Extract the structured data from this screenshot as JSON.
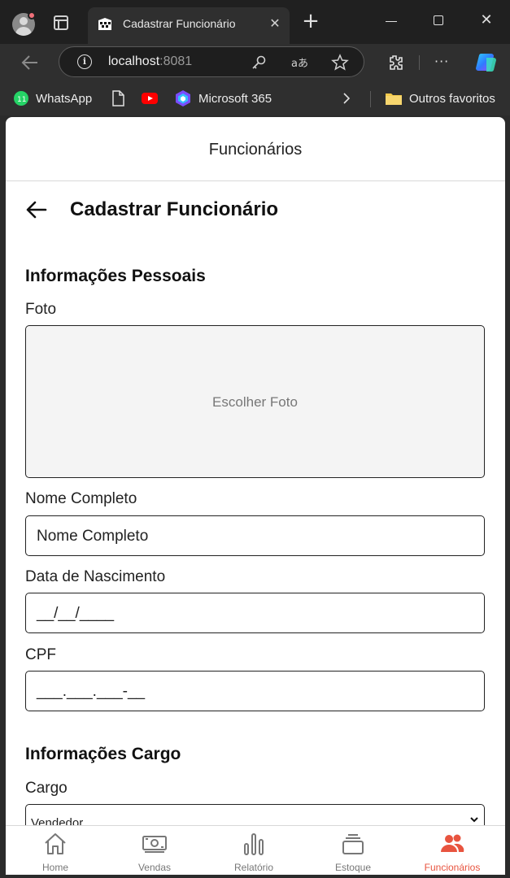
{
  "browser": {
    "tab_title": "Cadastrar Funcionário",
    "tab_close_glyph": "✕",
    "new_tab_glyph": "+",
    "window_close_glyph": "✕",
    "url_host": "localhost",
    "url_port": ":8081",
    "more_glyph": "···",
    "bookmarks": [
      {
        "label": "WhatsApp",
        "icon": "whatsapp-icon"
      },
      {
        "label": "",
        "icon": "document-icon"
      },
      {
        "label": "",
        "icon": "youtube-icon"
      },
      {
        "label": "Microsoft 365",
        "icon": "microsoft-365-icon"
      },
      {
        "label": "Outros favoritos",
        "icon": "folder-icon"
      }
    ]
  },
  "app": {
    "header_title": "Funcionários",
    "page_title": "Cadastrar Funcionário",
    "personal_section_title": "Informações Pessoais",
    "photo_label": "Foto",
    "photo_button": "Escolher Foto",
    "full_name_label": "Nome Completo",
    "full_name_placeholder": "Nome Completo",
    "birth_date_label": "Data de Nascimento",
    "birth_date_mask": "__/__/____",
    "cpf_label": "CPF",
    "cpf_mask": "___.___.___-__",
    "job_section_title": "Informações Cargo",
    "job_label": "Cargo",
    "job_selected": "Vendedor"
  },
  "bottom_nav": {
    "active": "Funcionários",
    "items": [
      {
        "label": "Home",
        "icon": "home-icon"
      },
      {
        "label": "Vendas",
        "icon": "money-icon"
      },
      {
        "label": "Relatório",
        "icon": "bar-chart-icon"
      },
      {
        "label": "Estoque",
        "icon": "stack-icon"
      },
      {
        "label": "Funcionários",
        "icon": "users-icon"
      }
    ]
  },
  "colors": {
    "accent": "#e8543f",
    "browser_dark": "#202020",
    "inactive_nav": "#777777"
  }
}
